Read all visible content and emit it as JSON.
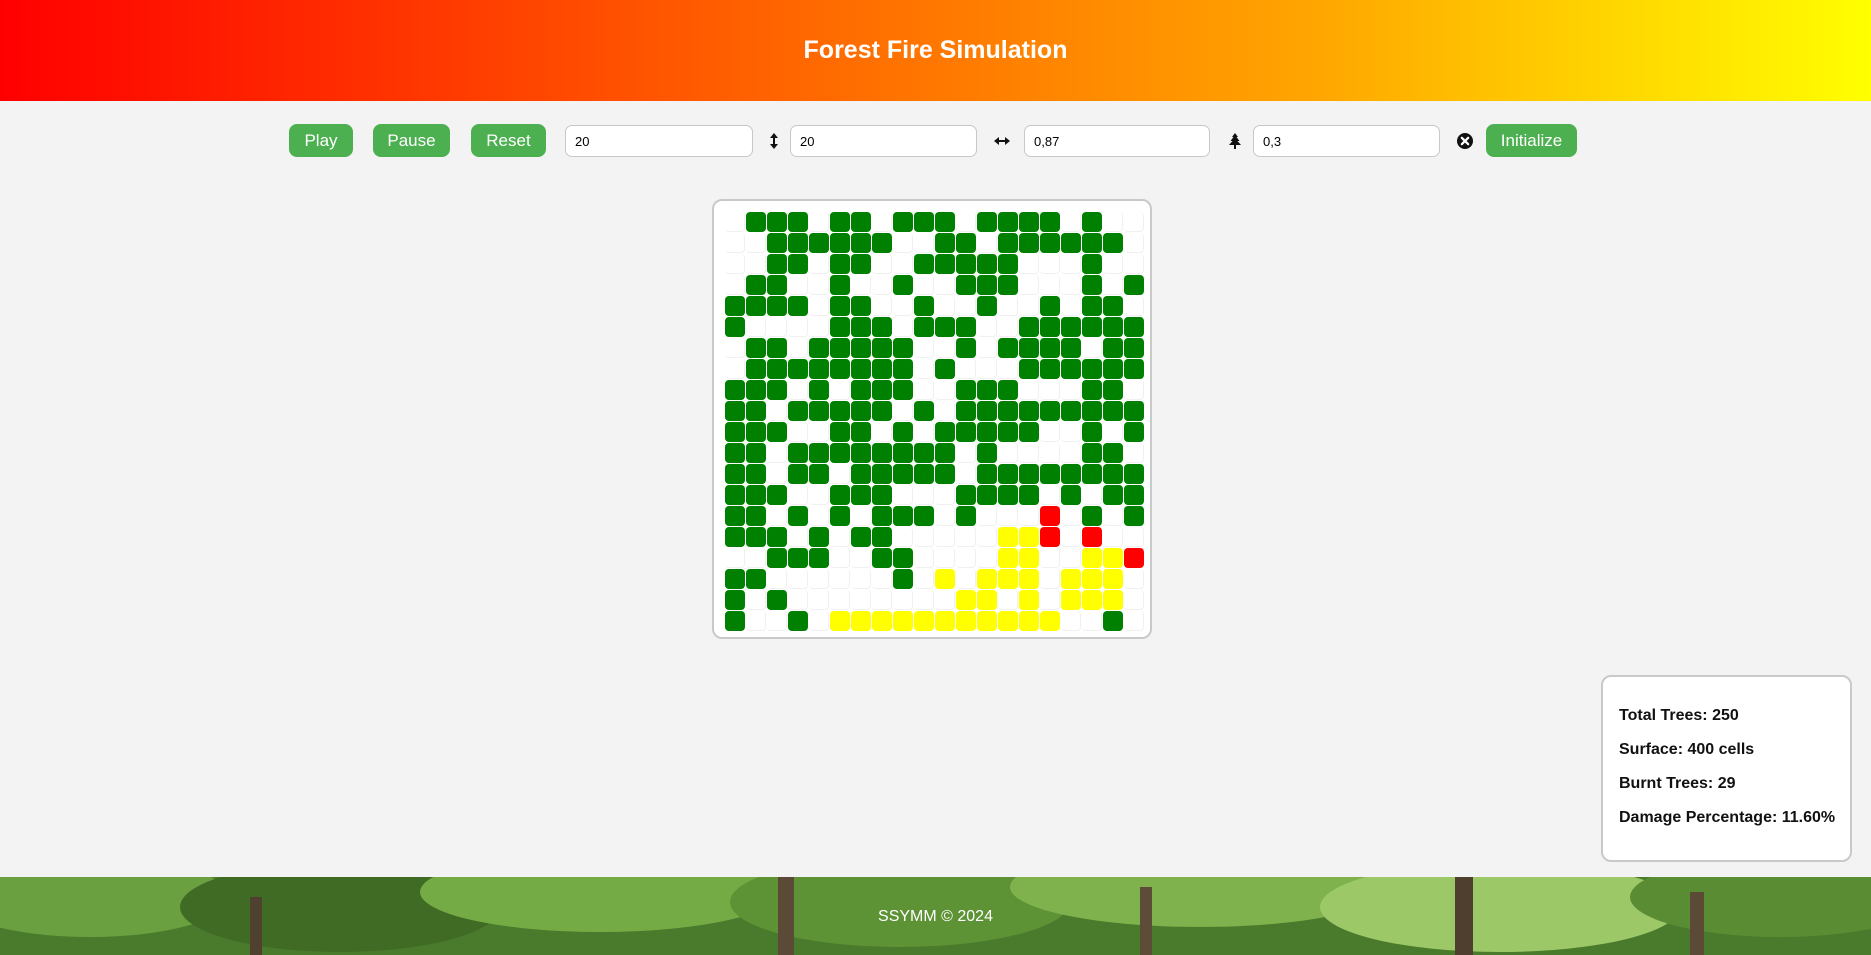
{
  "header": {
    "title": "Forest Fire Simulation"
  },
  "controls": {
    "play_label": "Play",
    "pause_label": "Pause",
    "reset_label": "Reset",
    "initialize_label": "Initialize",
    "height_value": "20",
    "width_value": "20",
    "density_value": "0,87",
    "probability_value": "0,3"
  },
  "icons": {
    "height": "vertical-arrows-icon",
    "width": "horizontal-arrows-icon",
    "tree": "tree-icon",
    "clear": "close-circle-icon"
  },
  "colors": {
    "tree": "#008000",
    "fire": "#ff0000",
    "burnt": "#ffff00",
    "empty": "#ffffff",
    "button": "#4caf50"
  },
  "grid": {
    "rows": 20,
    "cols": 20,
    "legend": "T=tree, F=fire, B=burnt, .=empty",
    "cells": [
      ".TTT.TT.TTT.TTTT.T..",
      "..TTTTTT..TT.TTTTTT.",
      "..TT.TT..TTTTT...T..",
      ".TT..T..T..TTT...T.T",
      "TTTT.TT..T..T..T.TT.",
      "T....TTT.TTT..TTTTTT",
      ".TT.TTTTT..T.TTTT.TT",
      ".TTTTTTTT.T...TTTTTT",
      "TTT.T.TTT..TTT...TT.",
      "TT.TTTTT.T.TTTTTTTTT",
      "TTT..TT.T.TTTTT..T.T",
      "TT.TTTTTTTT.T....TT.",
      "TT.TT.TTTTT.TTTTTTTT",
      "TTT..TTT...TTTT.T.TT",
      "TT.T.T.TTT.T...F.T.T",
      "TTT.T.TT.....BBF.F..",
      "..TTT..TT....BB..BBF",
      "TT......T.B.BBB.BBB.",
      "T.T........BB.B.BBB.T",
      "T..T.BBBBBBBBBBB..T.T"
    ]
  },
  "stats": {
    "total_trees": "Total Trees: 250",
    "surface": "Surface: 400 cells",
    "burnt_trees": "Burnt Trees: 29",
    "damage": "Damage Percentage: 11.60%"
  },
  "footer": {
    "text": "SSYMM © 2024"
  }
}
